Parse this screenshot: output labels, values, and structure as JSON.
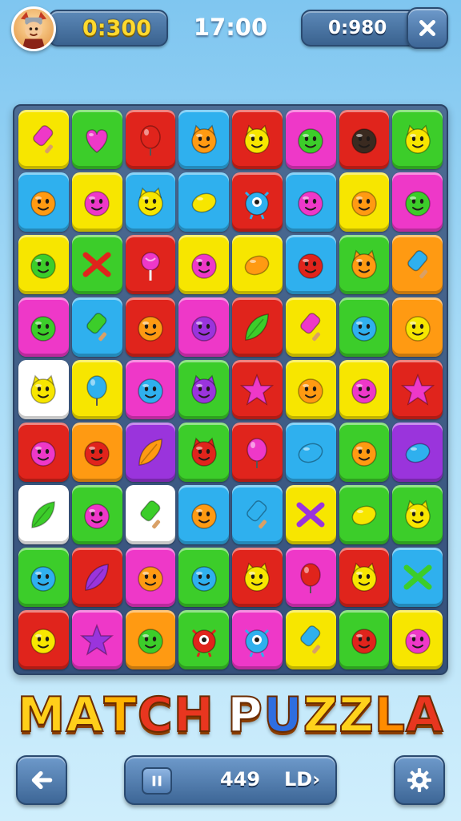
{
  "hud": {
    "score": "0:300",
    "timer": "17:00",
    "right_value": "0:980",
    "avatar_icon": "knight-avatar-icon",
    "close_icon": "close-icon"
  },
  "title": {
    "text": "MATCH PUZZLA",
    "letter_colors": [
      "#ffcf1a",
      "#ffcf1a",
      "#ffb300",
      "#e8361f",
      "#e8361f",
      "#ffffff",
      "#2e6ee0",
      "#ffd21c",
      "#ffd21c",
      "#ff8c00",
      "#e8361f",
      "#e8361f"
    ]
  },
  "bottom": {
    "moves": "449",
    "level": "LD›",
    "back_icon": "arrow-left-icon",
    "pause_icon": "pause-icon",
    "settings_icon": "gear-icon"
  },
  "colors": {
    "yellow": "#f7e600",
    "green": "#3ccd2a",
    "red": "#e0241c",
    "blue": "#2fb0ee",
    "pink": "#ee38c8",
    "orange": "#ff9a12",
    "purple": "#9a34dc",
    "white": "#ffffff"
  },
  "board": {
    "rows": [
      [
        [
          "yellow",
          "popsicle",
          "pink"
        ],
        [
          "green",
          "heart",
          "pink"
        ],
        [
          "red",
          "balloon",
          "red"
        ],
        [
          "blue",
          "cat-face",
          "orange"
        ],
        [
          "red",
          "cat-face",
          "yellow"
        ],
        [
          "pink",
          "face",
          "green"
        ],
        [
          "red",
          "face",
          "dark"
        ],
        [
          "green",
          "cat-face",
          "yellow"
        ]
      ],
      [
        [
          "blue",
          "face",
          "orange"
        ],
        [
          "yellow",
          "face",
          "pink"
        ],
        [
          "blue",
          "cat-face",
          "yellow"
        ],
        [
          "blue",
          "lemon",
          "yellow"
        ],
        [
          "red",
          "eye-monster",
          "blue"
        ],
        [
          "blue",
          "face",
          "pink"
        ],
        [
          "yellow",
          "face",
          "orange"
        ],
        [
          "pink",
          "face",
          "green"
        ]
      ],
      [
        [
          "yellow",
          "face",
          "green"
        ],
        [
          "green",
          "cross",
          "red"
        ],
        [
          "red",
          "candy",
          "pink"
        ],
        [
          "yellow",
          "face",
          "pink"
        ],
        [
          "yellow",
          "lemon",
          "orange"
        ],
        [
          "blue",
          "face",
          "red"
        ],
        [
          "green",
          "cat-face",
          "orange"
        ],
        [
          "orange",
          "popsicle",
          "blue"
        ]
      ],
      [
        [
          "pink",
          "face",
          "green"
        ],
        [
          "blue",
          "popsicle",
          "green"
        ],
        [
          "red",
          "face",
          "orange"
        ],
        [
          "pink",
          "face",
          "purple"
        ],
        [
          "red",
          "leaf",
          "green"
        ],
        [
          "yellow",
          "popsicle",
          "pink"
        ],
        [
          "green",
          "face",
          "blue"
        ],
        [
          "orange",
          "face",
          "yellow"
        ]
      ],
      [
        [
          "white",
          "cat-face",
          "yellow"
        ],
        [
          "yellow",
          "balloon",
          "blue"
        ],
        [
          "pink",
          "face",
          "blue"
        ],
        [
          "green",
          "cat-face",
          "purple"
        ],
        [
          "red",
          "star",
          "pink"
        ],
        [
          "yellow",
          "face",
          "orange"
        ],
        [
          "yellow",
          "face",
          "pink"
        ],
        [
          "red",
          "star",
          "pink"
        ]
      ],
      [
        [
          "red",
          "face",
          "pink"
        ],
        [
          "orange",
          "face",
          "red"
        ],
        [
          "purple",
          "leaf",
          "orange"
        ],
        [
          "green",
          "cat-face",
          "red"
        ],
        [
          "red",
          "balloon",
          "pink"
        ],
        [
          "blue",
          "lemon",
          "blue"
        ],
        [
          "green",
          "face",
          "orange"
        ],
        [
          "purple",
          "lemon",
          "blue"
        ]
      ],
      [
        [
          "white",
          "leaf",
          "green"
        ],
        [
          "green",
          "face",
          "pink"
        ],
        [
          "white",
          "popsicle",
          "green"
        ],
        [
          "blue",
          "face",
          "orange"
        ],
        [
          "blue",
          "popsicle",
          "blue"
        ],
        [
          "yellow",
          "cross",
          "purple"
        ],
        [
          "green",
          "lemon",
          "yellow"
        ],
        [
          "green",
          "cat-face",
          "yellow"
        ]
      ],
      [
        [
          "green",
          "face",
          "blue"
        ],
        [
          "red",
          "leaf",
          "purple"
        ],
        [
          "pink",
          "face",
          "orange"
        ],
        [
          "green",
          "face",
          "blue"
        ],
        [
          "red",
          "cat-face",
          "yellow"
        ],
        [
          "pink",
          "balloon",
          "red"
        ],
        [
          "red",
          "cat-face",
          "yellow"
        ],
        [
          "blue",
          "cross",
          "green"
        ]
      ],
      [
        [
          "red",
          "face",
          "yellow"
        ],
        [
          "pink",
          "star",
          "purple"
        ],
        [
          "orange",
          "face",
          "green"
        ],
        [
          "green",
          "eye-monster",
          "red"
        ],
        [
          "pink",
          "eye-monster",
          "blue"
        ],
        [
          "yellow",
          "popsicle",
          "blue"
        ],
        [
          "green",
          "face",
          "red"
        ],
        [
          "yellow",
          "face",
          "pink"
        ]
      ]
    ]
  }
}
